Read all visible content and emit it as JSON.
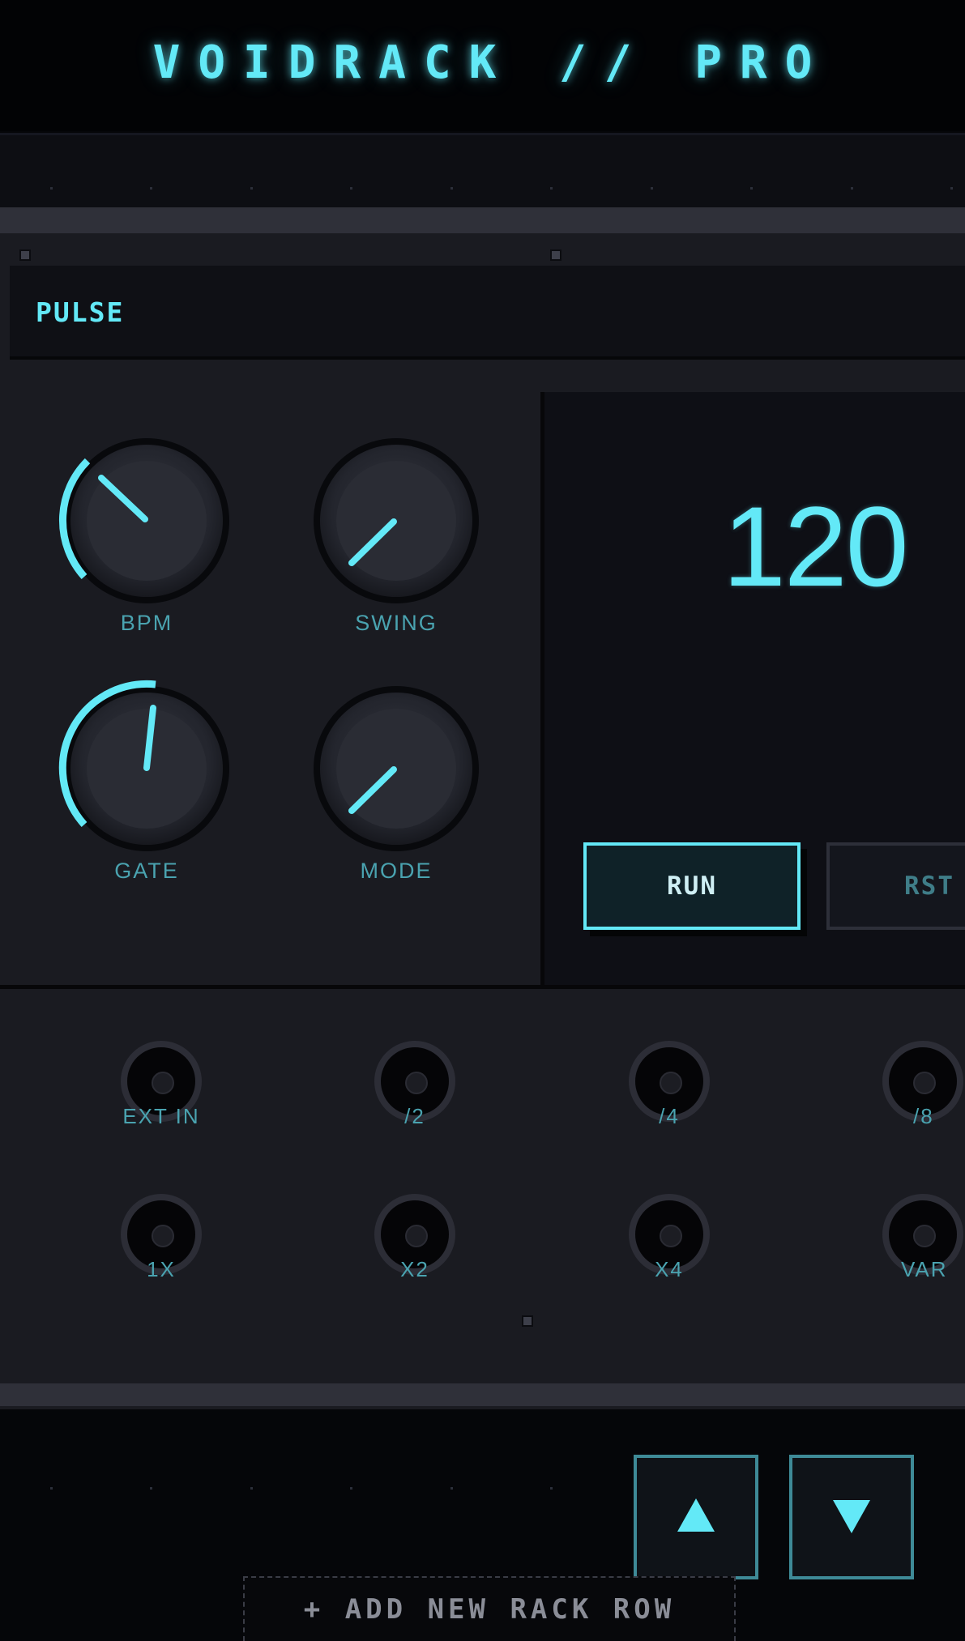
{
  "header": {
    "title": "VOIDRACK // PRO"
  },
  "module": {
    "name": "PULSE",
    "knobs": [
      {
        "label": "BPM"
      },
      {
        "label": "SWING"
      },
      {
        "label": "GATE"
      },
      {
        "label": "MODE"
      }
    ],
    "display": {
      "value": "120"
    },
    "buttons": {
      "run": "RUN",
      "reset": "RST"
    },
    "jacks": [
      "EXT IN",
      "/2",
      "/4",
      "/8",
      "1X",
      "X2",
      "X4",
      "VAR"
    ]
  },
  "nav": {
    "up_icon": "triangle-up-icon",
    "down_icon": "triangle-down-icon"
  },
  "add_row_label": "+ ADD NEW RACK ROW",
  "colors": {
    "accent": "#63e9f7",
    "panel": "#1a1b21",
    "background": "#050609"
  }
}
